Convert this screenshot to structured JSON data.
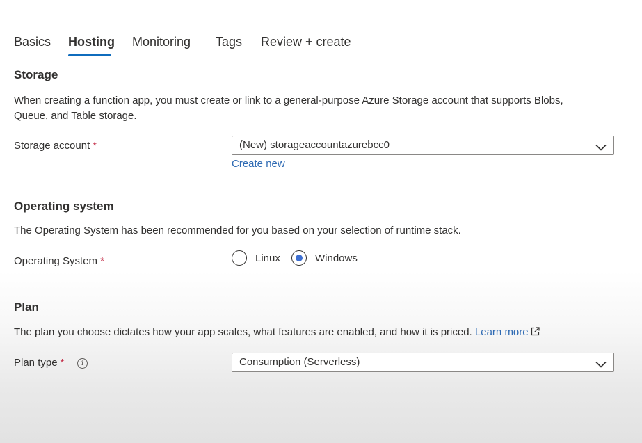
{
  "tabs": [
    {
      "label": "Basics",
      "active": false
    },
    {
      "label": "Hosting",
      "active": true
    },
    {
      "label": "Monitoring",
      "active": false
    },
    {
      "label": "Tags",
      "active": false
    },
    {
      "label": "Review + create",
      "active": false
    }
  ],
  "storage": {
    "title": "Storage",
    "description_line1": "When creating a function app, you must create or link to a general-purpose Azure Storage account that supports Blobs,",
    "description_line2": "Queue, and Table storage.",
    "account_label": "Storage account",
    "required_mark": "*",
    "account_value": "(New) storageaccountazurebcc0",
    "create_new_link": "Create new"
  },
  "operating_system": {
    "title": "Operating system",
    "description": "The Operating System has been recommended for you based on your selection of runtime stack.",
    "label": "Operating System",
    "required_mark": "*",
    "options": [
      {
        "label": "Linux",
        "selected": false
      },
      {
        "label": "Windows",
        "selected": true
      }
    ]
  },
  "plan": {
    "title": "Plan",
    "description": "The plan you choose dictates how your app scales, what features are enabled, and how it is priced.",
    "learn_more_link": "Learn more",
    "type_label": "Plan type",
    "required_mark": "*",
    "info_icon_glyph": "i",
    "type_value": "Consumption (Serverless)"
  },
  "colors": {
    "accent": "#0f6cbd",
    "link": "#2e6ab3",
    "required": "#c4314b",
    "radio_selected": "#3d6fd1"
  }
}
